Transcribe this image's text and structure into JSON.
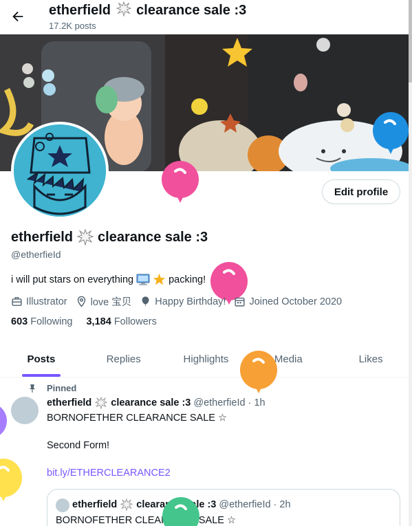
{
  "header": {
    "title": "etherfield",
    "title_suffix": "clearance sale :3",
    "posts_count": "17.2K posts"
  },
  "profile": {
    "edit_button": "Edit profile",
    "display_name": "etherfield",
    "display_name_suffix": "clearance sale :3",
    "handle": "@etherfieId",
    "bio_part1": "i will put stars on everything",
    "bio_part2": "packing!",
    "profession": "Illustrator",
    "location": "love 宝贝",
    "birthday": "Happy Birthday!",
    "joined": "Joined October 2020",
    "following_count": "603",
    "following_label": "Following",
    "followers_count": "3,184",
    "followers_label": "Followers"
  },
  "tabs": [
    {
      "label": "Posts",
      "active": true
    },
    {
      "label": "Replies",
      "active": false
    },
    {
      "label": "Highlights",
      "active": false
    },
    {
      "label": "Media",
      "active": false
    },
    {
      "label": "Likes",
      "active": false
    }
  ],
  "post": {
    "pinned_label": "Pinned",
    "author": "etherfield",
    "author_suffix": "clearance sale :3",
    "handle": "@etherfieId",
    "separator": "·",
    "time": "1h",
    "line1": "BORNOFETHER CLEARANCE SALE ☆",
    "line2": "Second Form!",
    "link": "bit.ly/ETHERCLEARANCE2",
    "quote": {
      "author": "etherfield",
      "author_suffix": "clearance sale :3",
      "handle": "@etherfieId",
      "separator": "·",
      "time": "2h",
      "body": "BORNOFETHER CLEARANCE SALE ☆"
    }
  },
  "colors": {
    "accent": "#7856ff",
    "balloon_pink": "#f0509c",
    "balloon_orange": "#f7a035",
    "balloon_blue": "#1d8fe0",
    "balloon_yellow": "#ffe14d",
    "balloon_purple": "#a67dff",
    "balloon_green": "#43c58b"
  },
  "icons": {
    "back": "arrow-left-icon",
    "profession": "briefcase-icon",
    "location": "location-pin-icon",
    "birthday": "balloon-icon",
    "joined": "calendar-icon",
    "pin": "pin-icon",
    "burst": "anger-burst-icon"
  }
}
